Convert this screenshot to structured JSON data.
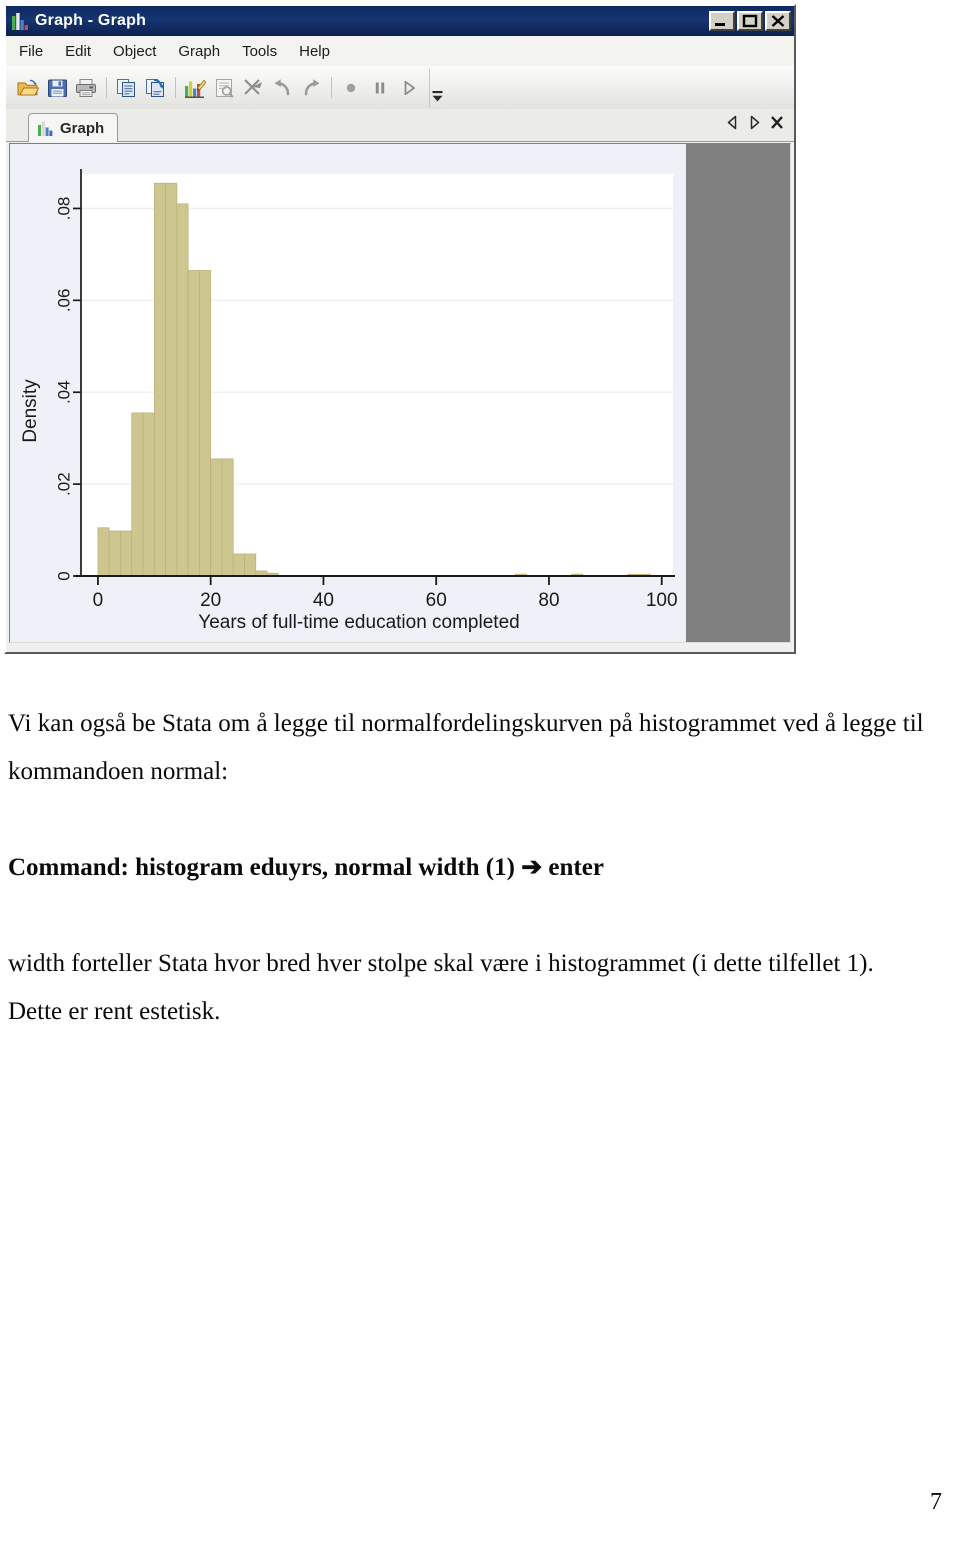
{
  "window": {
    "title": "Graph - Graph",
    "title_icon": "bar-chart-icon",
    "minimize_label": "_",
    "maximize_label": "□",
    "close_label": "✕"
  },
  "menu": {
    "items": [
      {
        "label": "File"
      },
      {
        "label": "Edit"
      },
      {
        "label": "Object"
      },
      {
        "label": "Graph"
      },
      {
        "label": "Tools"
      },
      {
        "label": "Help"
      }
    ]
  },
  "toolbar": {
    "buttons": [
      {
        "name": "open-icon"
      },
      {
        "name": "save-icon"
      },
      {
        "name": "print-icon"
      },
      {
        "name": "copy-icon"
      },
      {
        "name": "paste-icon"
      },
      {
        "name": "graph-editor-icon"
      },
      {
        "name": "log-icon"
      },
      {
        "name": "break-icon"
      },
      {
        "name": "undo-icon"
      },
      {
        "name": "redo-icon"
      },
      {
        "name": "record-icon"
      },
      {
        "name": "pause-icon"
      },
      {
        "name": "play-icon"
      }
    ],
    "overflow_icon": "chevron-down-icon"
  },
  "tabs": {
    "items": [
      {
        "label": "Graph",
        "icon": "bar-chart-icon",
        "active": true
      }
    ],
    "nav": {
      "prev_icon": "triangle-left-icon",
      "next_icon": "triangle-right-icon",
      "close_icon": "close-icon"
    }
  },
  "chart_data": {
    "type": "bar",
    "title": "",
    "xlabel": "Years of full-time education completed",
    "ylabel": "Density",
    "xlim": [
      -3,
      102
    ],
    "ylim": [
      0,
      0.0875
    ],
    "xticks": [
      0,
      20,
      40,
      60,
      80,
      100
    ],
    "xticklabels": [
      "0",
      "20",
      "40",
      "60",
      "80",
      "100"
    ],
    "yticks": [
      0,
      0.02,
      0.04,
      0.06,
      0.08
    ],
    "yticklabels": [
      "0",
      ".02",
      ".04",
      ".06",
      ".08"
    ],
    "grid": "horizontal",
    "bar_color": "#cdc68e",
    "bar_edge_color": "#b8b078",
    "plot_background": "#ffffff",
    "graph_background": "#eef1f7",
    "bin_width": 2,
    "bins": [
      {
        "x0": 0,
        "x1": 2,
        "value": 0.0105
      },
      {
        "x0": 2,
        "x1": 4,
        "value": 0.0098
      },
      {
        "x0": 4,
        "x1": 6,
        "value": 0.0098
      },
      {
        "x0": 6,
        "x1": 8,
        "value": 0.0355
      },
      {
        "x0": 8,
        "x1": 10,
        "value": 0.0355
      },
      {
        "x0": 10,
        "x1": 12,
        "value": 0.0855
      },
      {
        "x0": 12,
        "x1": 14,
        "value": 0.0855
      },
      {
        "x0": 14,
        "x1": 16,
        "value": 0.081
      },
      {
        "x0": 16,
        "x1": 18,
        "value": 0.0665
      },
      {
        "x0": 18,
        "x1": 20,
        "value": 0.0665
      },
      {
        "x0": 20,
        "x1": 22,
        "value": 0.0255
      },
      {
        "x0": 22,
        "x1": 24,
        "value": 0.0255
      },
      {
        "x0": 24,
        "x1": 26,
        "value": 0.0048
      },
      {
        "x0": 26,
        "x1": 28,
        "value": 0.0048
      },
      {
        "x0": 28,
        "x1": 30,
        "value": 0.0011
      },
      {
        "x0": 30,
        "x1": 32,
        "value": 0.0006
      },
      {
        "x0": 74,
        "x1": 76,
        "value": 0.0004
      },
      {
        "x0": 84,
        "x1": 86,
        "value": 0.0004
      },
      {
        "x0": 94,
        "x1": 98,
        "value": 0.0004
      }
    ]
  },
  "document": {
    "paragraph_1": "Vi kan også be Stata om å legge til normalfordelingskurven på histogrammet ved å legge til kommandoen normal:",
    "command_line": "Command: histogram eduyrs, normal width (1) ➔ enter",
    "paragraph_2": "width forteller Stata hvor bred hver stolpe skal være i histogrammet (i dette tilfellet 1). Dette er rent estetisk.",
    "page_number": "7"
  }
}
